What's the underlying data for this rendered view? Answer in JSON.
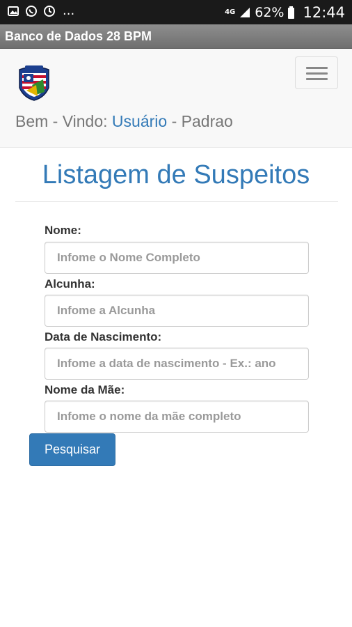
{
  "status_bar": {
    "network": "4G",
    "battery": "62%",
    "time": "12:44",
    "overflow": "...",
    "left_icons": [
      "gallery-icon",
      "whatsapp-icon",
      "sync-icon"
    ],
    "right_icons": [
      "signal-icon",
      "battery-icon"
    ]
  },
  "app_bar": {
    "title": "Banco de Dados 28 BPM"
  },
  "navbar": {
    "welcome_prefix": "Bem - Vindo:",
    "user": "Usuário",
    "separator": "-",
    "role": "Padrao",
    "menu_icon": "hamburger-menu-icon",
    "logo": "police-battalion-crest"
  },
  "page": {
    "title": "Listagem de Suspeitos"
  },
  "form": {
    "nome": {
      "label": "Nome:",
      "placeholder": "Infome o Nome Completo",
      "value": ""
    },
    "alcunha": {
      "label": "Alcunha:",
      "placeholder": "Infome a Alcunha",
      "value": ""
    },
    "nascimento": {
      "label": "Data de Nascimento:",
      "placeholder": "Infome a data de nascimento - Ex.: ano",
      "value": ""
    },
    "mae": {
      "label": "Nome da Mãe:",
      "placeholder": "Infome o nome da mãe completo",
      "value": ""
    },
    "submit_label": "Pesquisar"
  },
  "colors": {
    "primary": "#337ab7",
    "status_bar": "#1a1a1a",
    "app_bar": "#7f7f7f",
    "navbar_bg": "#f8f8f8",
    "muted_text": "#777777"
  }
}
